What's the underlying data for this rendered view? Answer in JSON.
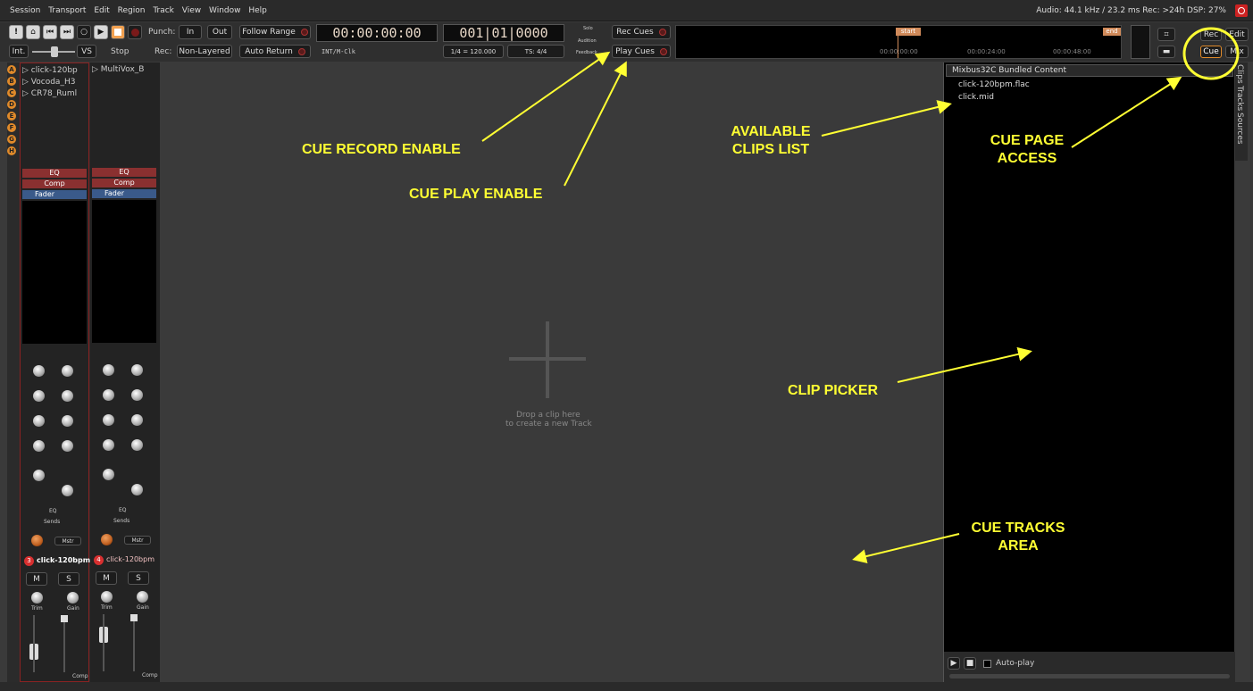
{
  "menubar": {
    "items": [
      "Session",
      "Transport",
      "Edit",
      "Region",
      "Track",
      "View",
      "Window",
      "Help"
    ],
    "status": "Audio: 44.1 kHz / 23.2 ms  Rec: >24h  DSP: 27%"
  },
  "toolbar": {
    "int": "Int.",
    "vs": "VS",
    "stop": "Stop",
    "punch": "Punch:",
    "in": "In",
    "out": "Out",
    "rec": "Rec:",
    "non_layered": "Non-Layered",
    "follow_range": "Follow Range",
    "auto_return": "Auto Return",
    "clock1": "00:00:00:00",
    "clock1_sub": "INT/M-Clk",
    "clock2": "001|01|0000",
    "tempo": "1/4 = 120.000",
    "ts": "TS: 4/4",
    "solo": "Solo",
    "audition": "Audition",
    "feedback": "Feedback",
    "rec_cues": "Rec Cues",
    "play_cues": "Play Cues",
    "start_marker": "start",
    "end_marker": "end",
    "tl_t0": "00:00:00:00",
    "tl_t1": "00:00:24:00",
    "tl_t2": "00:00:48:00",
    "rec_btn": "Rec",
    "edit_btn": "Edit",
    "cue_btn": "Cue",
    "mix_btn": "Mix"
  },
  "cues": {
    "letters": [
      "A",
      "B",
      "C",
      "D",
      "E",
      "F",
      "G",
      "H"
    ],
    "strip1": [
      "click-120bp",
      "Vocoda_H3",
      "CR78_Ruml"
    ],
    "strip2": [
      "MultiVox_B"
    ]
  },
  "strips": [
    {
      "eq": "EQ",
      "comp": "Comp",
      "fader": "Fader",
      "eq2": "EQ",
      "sends": "Sends",
      "mstr": "Mstr",
      "num": "3",
      "name": "click-120bpm",
      "m": "M",
      "s": "S",
      "trim": "Trim",
      "gain": "Gain",
      "comp_label": "Comp"
    },
    {
      "eq": "EQ",
      "comp": "Comp",
      "fader": "Fader",
      "eq2": "EQ",
      "sends": "Sends",
      "mstr": "Mstr",
      "num": "4",
      "name": "click-120bpm",
      "m": "M",
      "s": "S",
      "trim": "Trim",
      "gain": "Gain",
      "comp_label": "Comp"
    }
  ],
  "main": {
    "drop1": "Drop a clip here",
    "drop2": "to create a new Track"
  },
  "rightpanel": {
    "source": "Mixbus32C Bundled Content",
    "clips": [
      "click-120bpm.flac",
      "click.mid"
    ],
    "autoplay": "Auto-play"
  },
  "sidetabs": [
    "Clips",
    "Tracks",
    "Sources"
  ],
  "annotations": {
    "cue_record": "CUE RECORD ENABLE",
    "cue_play": "CUE PLAY ENABLE",
    "clips1": "AVAILABLE",
    "clips2": "CLIPS LIST",
    "cue_page1": "CUE PAGE",
    "cue_page2": "ACCESS",
    "clip_picker": "CLIP PICKER",
    "cue_tracks1": "CUE TRACKS",
    "cue_tracks2": "AREA"
  },
  "colors": {
    "annotation": "#ffff33",
    "accent": "#e08a2a",
    "record": "#c22222"
  }
}
